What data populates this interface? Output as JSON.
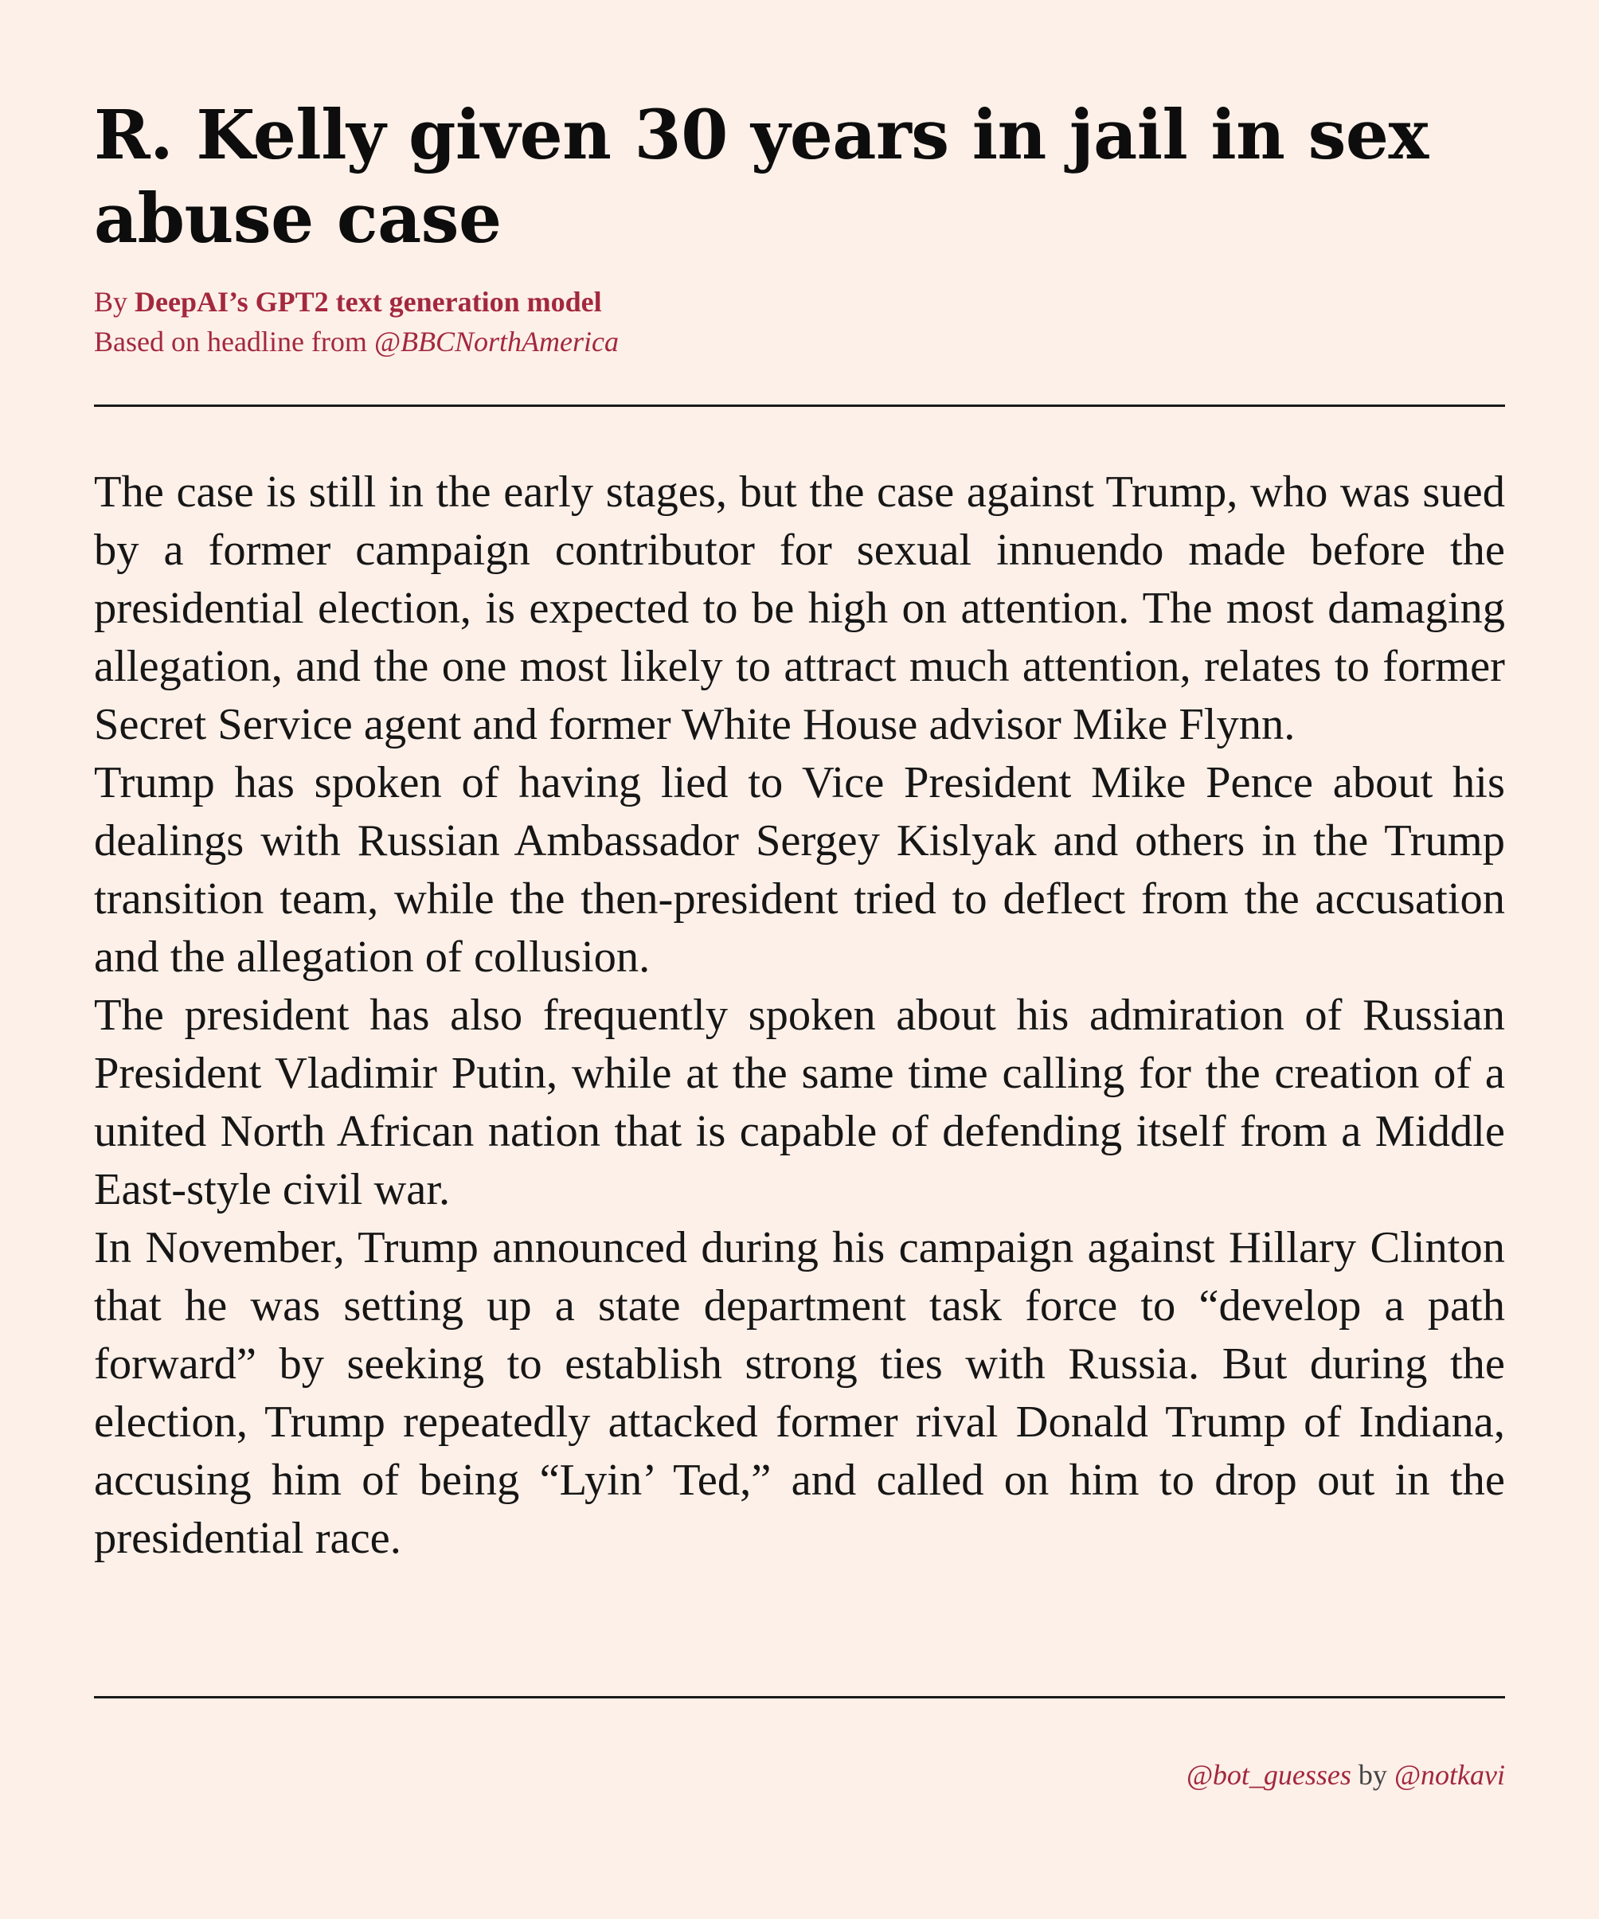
{
  "article": {
    "headline": "R. Kelly given 30 years in jail in sex abuse case",
    "byline_prefix": "By ",
    "byline_author": "DeepAI’s GPT2 text generation model",
    "source_prefix": "Based on headline from ",
    "source_handle": "@BBCNorthAmerica",
    "paragraphs": [
      "The case is still in the early stages, but the case against Trump, who was sued by a former campaign contributor for sexual innuendo made before the presidential election, is expected to be high on attention.  The most damaging allegation, and the one most likely to attract much attention, relates to former Secret Service agent and former White House advisor Mike Flynn.",
      "Trump has spoken of having lied to Vice President Mike Pence about his dealings with Russian Ambassador Sergey Kislyak and others in the Trump transition team, while the then-president tried to deflect from the accusation and the allegation of collusion.",
      "The president has also frequently spoken about his admiration of Russian President Vladimir Putin, while at the same time calling for the creation of a united North African nation that is capable of defending itself from a Middle East-style civil war.",
      "In November, Trump announced during his campaign against Hillary Clinton that he was setting up a state department task force to “develop a path forward” by seeking to establish strong ties with Russia.  But during the election, Trump repeatedly attacked former rival Donald Trump of Indiana, accusing him of being “Lyin’ Ted,” and called on him to drop out in the presidential race."
    ]
  },
  "footer": {
    "bot_handle": "@bot_guesses",
    "by_text": " by ",
    "author_handle": "@notkavi"
  },
  "colors": {
    "background": "#fdf0e8",
    "accent": "#a3283e",
    "text": "#161616"
  }
}
